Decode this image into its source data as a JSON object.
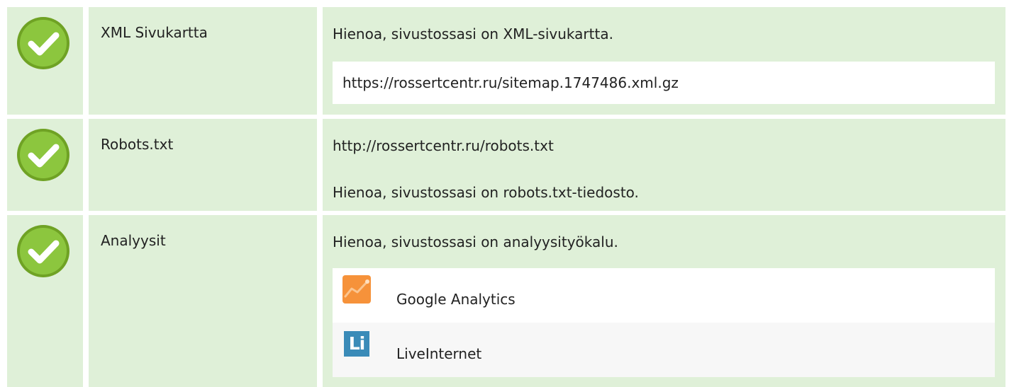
{
  "colors": {
    "row_background": "#dff0d8",
    "check_green": "#8cc63e",
    "ga_orange": "#f6923a",
    "li_blue": "#3a8bb8"
  },
  "rows": [
    {
      "status_icon": "check-icon",
      "label": "XML Sivukartta",
      "message": "Hienoa, sivustossasi on XML-sivukartta.",
      "url": "https://rossertcentr.ru/sitemap.1747486.xml.gz"
    },
    {
      "status_icon": "check-icon",
      "label": "Robots.txt",
      "url": "http://rossertcentr.ru/robots.txt",
      "message": "Hienoa, sivustossasi on robots.txt-tiedosto."
    },
    {
      "status_icon": "check-icon",
      "label": "Analyysit",
      "message": "Hienoa, sivustossasi on analyysityökalu.",
      "tools": [
        {
          "name": "Google Analytics",
          "icon": "google-analytics-icon"
        },
        {
          "name": "LiveInternet",
          "icon": "liveinternet-icon",
          "logo_text": "Li"
        }
      ]
    }
  ]
}
